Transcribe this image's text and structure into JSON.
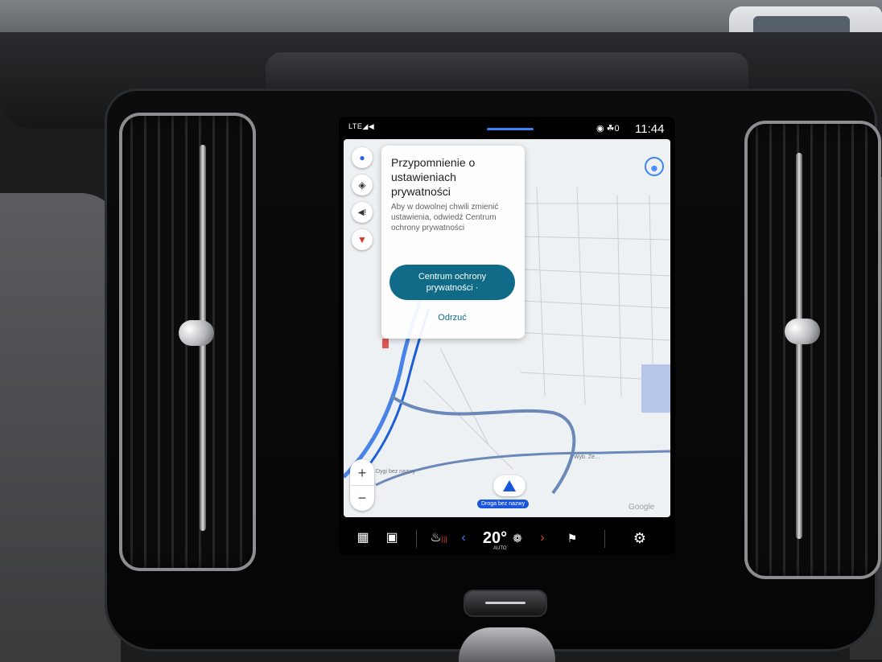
{
  "status_bar": {
    "signal": "LTE◢◀",
    "icons": "◉ ☘0",
    "time": "11:44"
  },
  "map": {
    "controls": {
      "mic_icon": "microphone-icon",
      "layers_icon": "layers-icon",
      "sound_icon": "sound-icon",
      "report_icon": "report-icon",
      "zoom_in": "+",
      "zoom_out": "−"
    },
    "watermark": "Google",
    "road_name": "Droga bez nazwy",
    "labels": [
      "Wyb. Ze…",
      "Dygi bez nazwy"
    ]
  },
  "privacy_card": {
    "title": "Przypomnienie o ustawieniach prywatności",
    "body": "Aby w dowolnej chwili zmienić ustawienia, odwiedź Centrum ochrony prywatności",
    "primary_button": "Centrum ochrony prywatności ·",
    "dismiss_button": "Odrzuć"
  },
  "climate_bar": {
    "temperature": "20°",
    "auto_label": "AUTO",
    "seat_heat_dots": "|||",
    "arrow_left": "‹",
    "arrow_right": "›"
  }
}
